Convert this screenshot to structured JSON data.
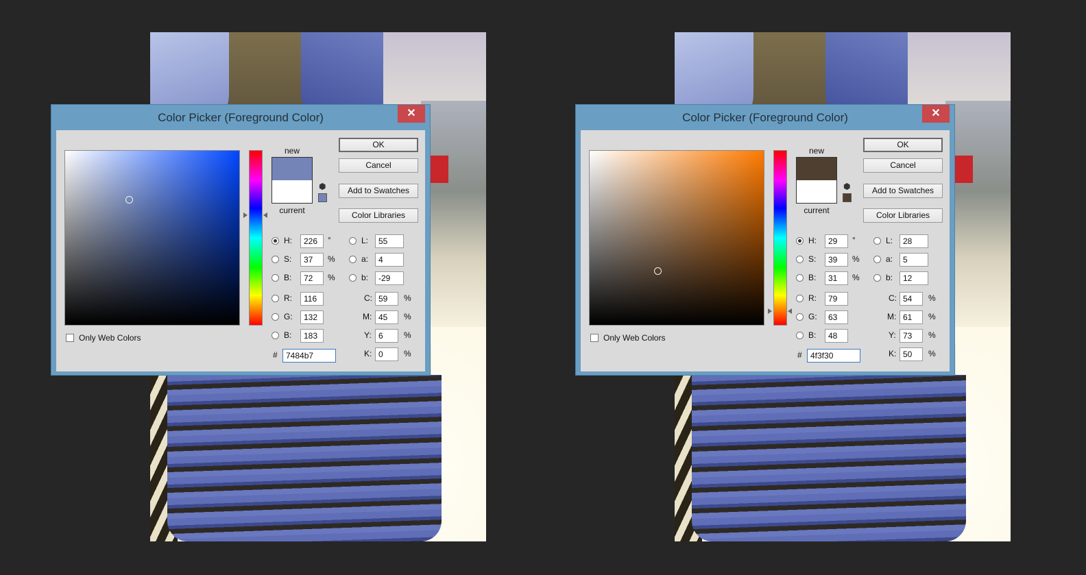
{
  "pickers": [
    {
      "title": "Color Picker (Foreground Color)",
      "close_symbol": "✕",
      "new_label": "new",
      "current_label": "current",
      "new_color": "#7484b7",
      "current_color": "#ffffff",
      "hue_color": "#0047ff",
      "buttons": {
        "ok": "OK",
        "cancel": "Cancel",
        "add_to_swatches": "Add to Swatches",
        "color_libraries": "Color Libraries"
      },
      "only_web_colors": "Only Web Colors",
      "fields": {
        "H": "226",
        "S": "37",
        "B_hsb": "72",
        "R": "116",
        "G": "132",
        "B_rgb": "183",
        "L": "55",
        "a": "4",
        "b_lab": "-29",
        "C": "59",
        "M": "45",
        "Y": "6",
        "K": "0",
        "hex": "7484b7"
      },
      "labels": {
        "H": "H:",
        "S": "S:",
        "B": "B:",
        "R": "R:",
        "G": "G:",
        "L": "L:",
        "a": "a:",
        "b": "b:",
        "C": "C:",
        "M": "M:",
        "Y": "Y:",
        "K": "K:",
        "hash": "#"
      },
      "units": {
        "deg": "°",
        "pct": "%"
      },
      "marker": {
        "saturation": 0.37,
        "brightness": 0.72
      },
      "hue_slider_value": 226
    },
    {
      "title": "Color Picker (Foreground Color)",
      "close_symbol": "✕",
      "new_label": "new",
      "current_label": "current",
      "new_color": "#4f3f30",
      "current_color": "#ffffff",
      "hue_color": "#ff7a00",
      "buttons": {
        "ok": "OK",
        "cancel": "Cancel",
        "add_to_swatches": "Add to Swatches",
        "color_libraries": "Color Libraries"
      },
      "only_web_colors": "Only Web Colors",
      "fields": {
        "H": "29",
        "S": "39",
        "B_hsb": "31",
        "R": "79",
        "G": "63",
        "B_rgb": "48",
        "L": "28",
        "a": "5",
        "b_lab": "12",
        "C": "54",
        "M": "61",
        "Y": "73",
        "K": "50",
        "hex": "4f3f30"
      },
      "labels": {
        "H": "H:",
        "S": "S:",
        "B": "B:",
        "R": "R:",
        "G": "G:",
        "L": "L:",
        "a": "a:",
        "b": "b:",
        "C": "C:",
        "M": "M:",
        "Y": "Y:",
        "K": "K:",
        "hash": "#"
      },
      "units": {
        "deg": "°",
        "pct": "%"
      },
      "marker": {
        "saturation": 0.39,
        "brightness": 0.31
      },
      "hue_slider_value": 29
    }
  ]
}
